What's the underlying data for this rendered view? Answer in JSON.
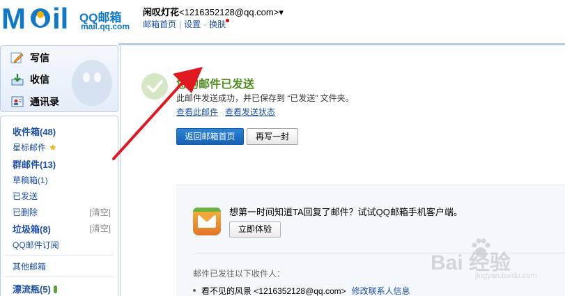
{
  "header": {
    "logo_main": "M il",
    "logo_qq": "QQ邮箱",
    "logo_domain": "mail.qq.com",
    "nickname": "闲叹灯花",
    "email": "<1216352128@qq.com>",
    "dropdown": "▾",
    "links": [
      "邮箱首页",
      "设置",
      "换肤"
    ],
    "link_sep": "|",
    "link_dash": "-"
  },
  "compose": {
    "write": "写信",
    "receive": "收信",
    "contacts": "通讯录"
  },
  "folders": {
    "inbox": "收件箱(48)",
    "starred": "星标邮件",
    "starred_icon": "★",
    "group": "群邮件(13)",
    "drafts": "草稿箱(1)",
    "sent": "已发送",
    "deleted": "已删除",
    "deleted_clear": "[清空]",
    "spam": "垃圾箱(8)",
    "spam_clear": "[清空]",
    "subscription": "QQ邮件订阅",
    "other": "其他邮箱",
    "drift": "漂流瓶(5)"
  },
  "main": {
    "title": "您的邮件已发送",
    "description": "此邮件发送成功，并已保存到 “已发送” 文件夹。",
    "link_view": "查看此邮件",
    "link_status": "查看发送状态",
    "btn_back": "返回邮箱首页",
    "btn_rewrite": "再写一封",
    "promo_text": "想第一时间知道TA回复了邮件？试试QQ邮箱手机客户端。",
    "promo_btn": "立即体验",
    "recipients_label": "邮件已发往以下收件人：",
    "recipient": "看不见的风景 <1216352128@qq.com>",
    "recipient_edit": "修改联系人信息"
  },
  "watermark": {
    "text": "Bai  经验",
    "sub": "jingyan.baidu.com"
  },
  "colors": {
    "brand_blue": "#0e78c9",
    "link_blue": "#1d50a5",
    "success_green": "#4c8d20",
    "arrow_red": "#e0191f"
  }
}
